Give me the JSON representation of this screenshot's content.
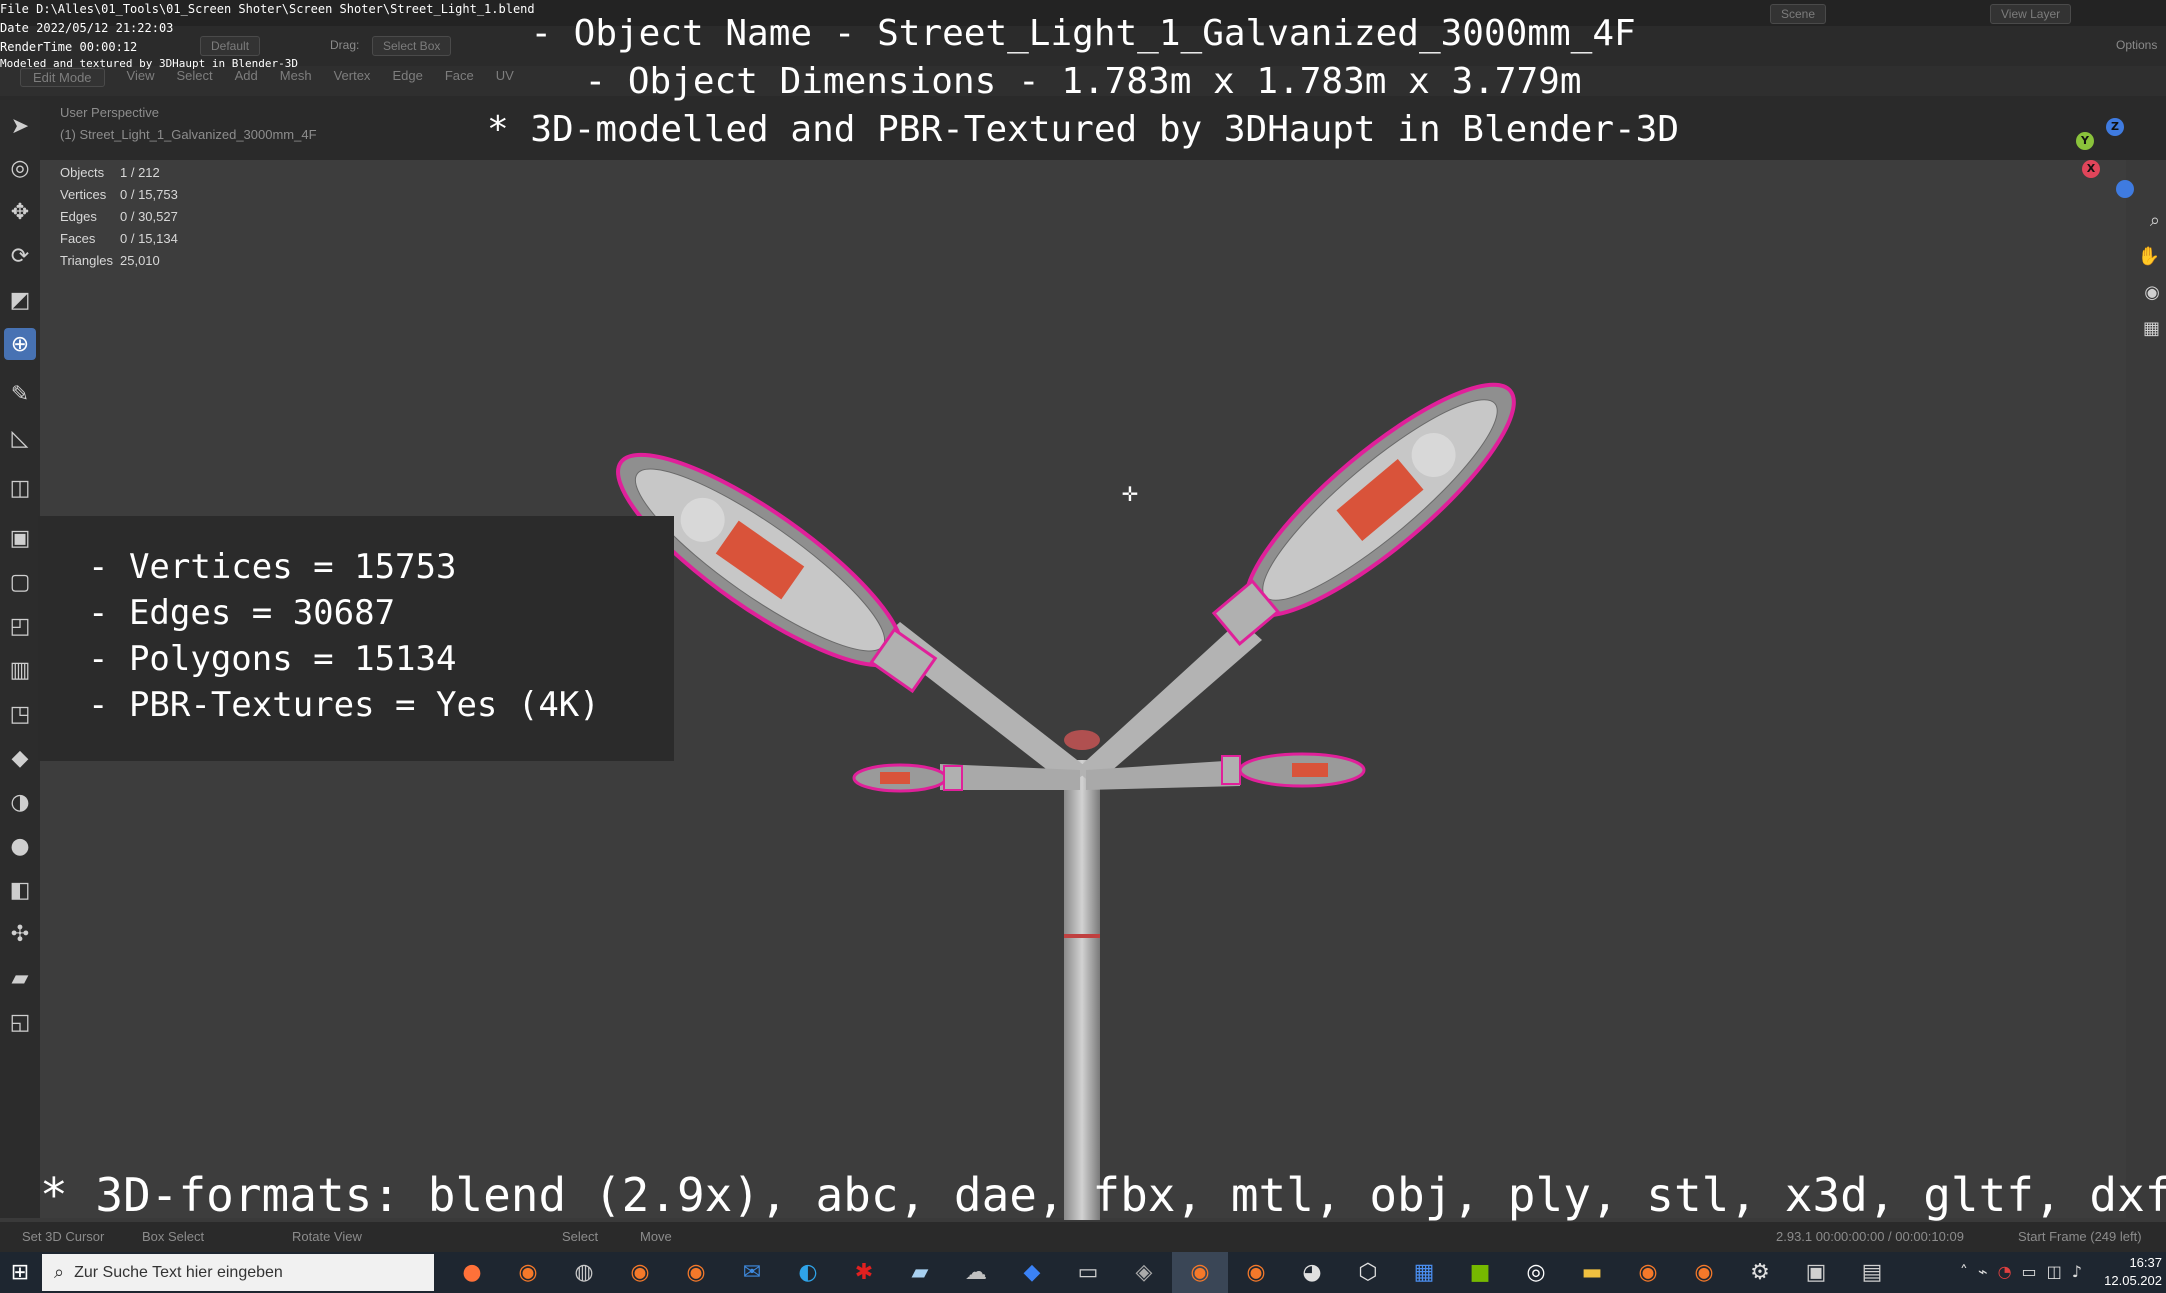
{
  "meta": {
    "file_line": "File D:\\Alles\\01_Tools\\01_Screen Shoter\\Screen Shoter\\Street_Light_1.blend",
    "date_line": "Date 2022/05/12 21:22:03",
    "rendertime_line": "RenderTime 00:00:12",
    "modeled_line": "Modeled and textured by 3DHaupt in Blender-3D"
  },
  "overlay": {
    "line1": "- Object Name - Street_Light_1_Galvanized_3000mm_4F",
    "line2": "- Object Dimensions -  1.783m x 1.783m x 3.779m",
    "line3": "* 3D-modelled and PBR-Textured by 3DHaupt in Blender-3D"
  },
  "header": {
    "orientation": "Default",
    "drag_label": "Drag:",
    "drag_value": "Select Box",
    "scene": "Scene",
    "view_layer": "View Layer",
    "options": "Options",
    "mode": "Edit Mode",
    "menu": [
      "View",
      "Select",
      "Add",
      "Mesh",
      "Vertex",
      "Edge",
      "Face",
      "UV"
    ]
  },
  "viewport": {
    "perspective": "User Perspective",
    "collection": "(1) Street_Light_1_Galvanized_3000mm_4F"
  },
  "stats": [
    {
      "key": "Objects",
      "value": "1 / 212"
    },
    {
      "key": "Vertices",
      "value": "0 / 15,753"
    },
    {
      "key": "Edges",
      "value": "0 / 30,527"
    },
    {
      "key": "Faces",
      "value": "0 / 15,134"
    },
    {
      "key": "Triangles",
      "value": "25,010"
    }
  ],
  "mesh_info": {
    "vertices": "- Vertices = 15753",
    "edges": "- Edges = 30687",
    "polygons": "- Polygons = 15134",
    "textures": "- PBR-Textures =  Yes (4K)"
  },
  "formats": "* 3D-formats: blend (2.9x), abc, dae, fbx, mtl, obj, ply, stl, x3d, gltf, dxf",
  "statusbar": {
    "cursor": "Set 3D Cursor",
    "box_select": "Box Select",
    "rotate": "Rotate View",
    "select": "Select",
    "move": "Move",
    "version_time": "2.93.1  00:00:00:00 / 00:00:10:09",
    "start_frame": "Start Frame (249 left)"
  },
  "taskbar": {
    "search_placeholder": "Zur Suche Text hier eingeben",
    "time": "16:37",
    "date": "12.05.202"
  },
  "colors": {
    "active_tool": "#4772b3",
    "gizmo_x": "#e0455a",
    "gizmo_y": "#8ac33b",
    "gizmo_z": "#3f7be0",
    "edge_highlight": "#e0209a"
  }
}
